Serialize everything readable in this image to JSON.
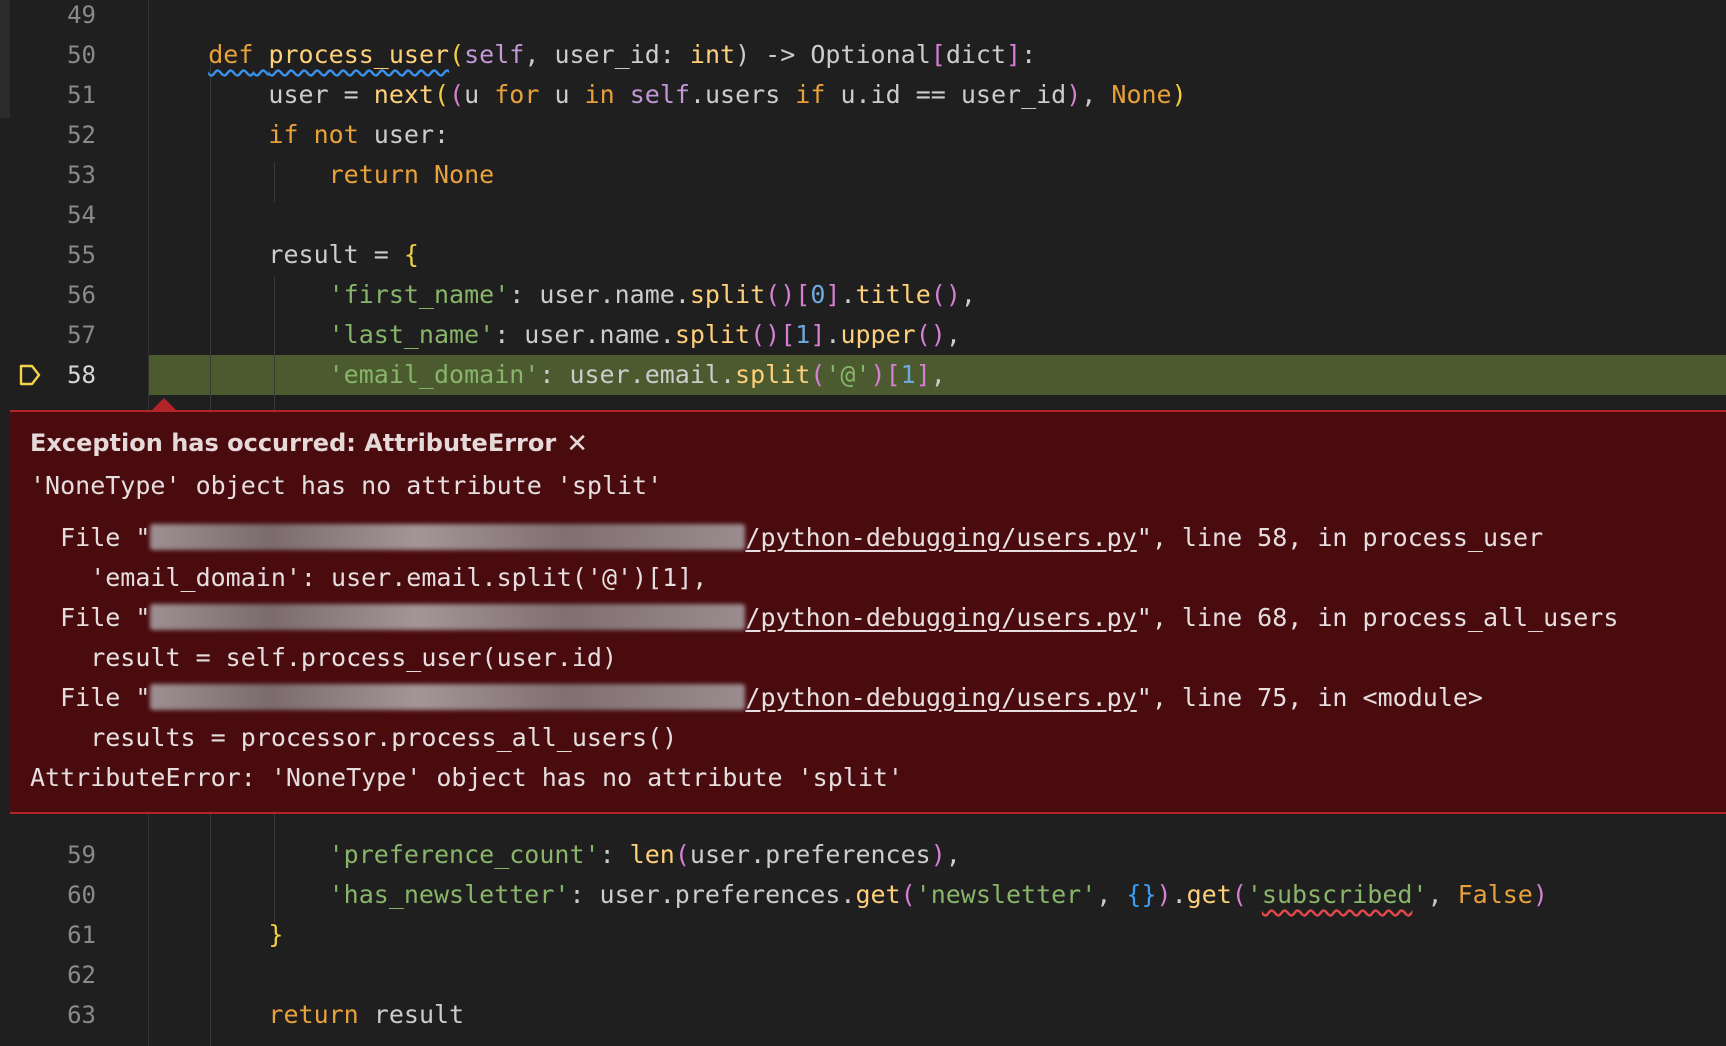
{
  "editor": {
    "lines_top": [
      {
        "num": "49",
        "segments": []
      },
      {
        "num": "50",
        "segments": [
          {
            "t": "    "
          },
          {
            "t": "def",
            "c": "kw-def squiggle-blue"
          },
          {
            "t": " ",
            "c": "squiggle-blue"
          },
          {
            "t": "process_user",
            "c": "fn squiggle-blue"
          },
          {
            "t": "(",
            "c": "p1"
          },
          {
            "t": "self",
            "c": "slf"
          },
          {
            "t": ", user_id: "
          },
          {
            "t": "int",
            "c": "builtin"
          },
          {
            "t": ") -> Optional"
          },
          {
            "t": "[",
            "c": "p2"
          },
          {
            "t": "dict"
          },
          {
            "t": "]",
            "c": "p2"
          },
          {
            "t": ":"
          }
        ]
      },
      {
        "num": "51",
        "segments": [
          {
            "t": "        user = "
          },
          {
            "t": "next",
            "c": "fn"
          },
          {
            "t": "(",
            "c": "p1"
          },
          {
            "t": "(",
            "c": "p2"
          },
          {
            "t": "u "
          },
          {
            "t": "for",
            "c": "kw"
          },
          {
            "t": " u "
          },
          {
            "t": "in",
            "c": "kw"
          },
          {
            "t": " "
          },
          {
            "t": "self",
            "c": "slf"
          },
          {
            "t": ".users "
          },
          {
            "t": "if",
            "c": "kw"
          },
          {
            "t": " u.id == user_id"
          },
          {
            "t": ")",
            "c": "p2"
          },
          {
            "t": ", "
          },
          {
            "t": "None",
            "c": "const"
          },
          {
            "t": ")",
            "c": "p1"
          }
        ]
      },
      {
        "num": "52",
        "segments": [
          {
            "t": "        "
          },
          {
            "t": "if",
            "c": "kw"
          },
          {
            "t": " "
          },
          {
            "t": "not",
            "c": "kw"
          },
          {
            "t": " user:"
          }
        ]
      },
      {
        "num": "53",
        "segments": [
          {
            "t": "            "
          },
          {
            "t": "return",
            "c": "kw"
          },
          {
            "t": " "
          },
          {
            "t": "None",
            "c": "const"
          }
        ]
      },
      {
        "num": "54",
        "segments": []
      },
      {
        "num": "55",
        "segments": [
          {
            "t": "        result = "
          },
          {
            "t": "{",
            "c": "p1"
          }
        ]
      },
      {
        "num": "56",
        "segments": [
          {
            "t": "            "
          },
          {
            "t": "'first_name'",
            "c": "str"
          },
          {
            "t": ": user.name."
          },
          {
            "t": "split",
            "c": "fn"
          },
          {
            "t": "()",
            "c": "p2"
          },
          {
            "t": "[",
            "c": "p2"
          },
          {
            "t": "0",
            "c": "num"
          },
          {
            "t": "]",
            "c": "p2"
          },
          {
            "t": "."
          },
          {
            "t": "title",
            "c": "fn"
          },
          {
            "t": "()",
            "c": "p2"
          },
          {
            "t": ","
          }
        ]
      },
      {
        "num": "57",
        "segments": [
          {
            "t": "            "
          },
          {
            "t": "'last_name'",
            "c": "str"
          },
          {
            "t": ": user.name."
          },
          {
            "t": "split",
            "c": "fn"
          },
          {
            "t": "()",
            "c": "p2"
          },
          {
            "t": "[",
            "c": "p2"
          },
          {
            "t": "1",
            "c": "num"
          },
          {
            "t": "]",
            "c": "p2"
          },
          {
            "t": "."
          },
          {
            "t": "upper",
            "c": "fn"
          },
          {
            "t": "()",
            "c": "p2"
          },
          {
            "t": ","
          }
        ]
      },
      {
        "num": "58",
        "segments": [
          {
            "t": "            "
          },
          {
            "t": "'email_domain'",
            "c": "str"
          },
          {
            "t": ": user.email."
          },
          {
            "t": "split",
            "c": "fn"
          },
          {
            "t": "(",
            "c": "p2"
          },
          {
            "t": "'@'",
            "c": "str"
          },
          {
            "t": ")",
            "c": "p2"
          },
          {
            "t": "[",
            "c": "p2"
          },
          {
            "t": "1",
            "c": "num"
          },
          {
            "t": "]",
            "c": "p2"
          },
          {
            "t": ","
          }
        ]
      }
    ],
    "lines_bottom": [
      {
        "num": "59",
        "segments": [
          {
            "t": "            "
          },
          {
            "t": "'preference_count'",
            "c": "str"
          },
          {
            "t": ": "
          },
          {
            "t": "len",
            "c": "fn"
          },
          {
            "t": "(",
            "c": "p2"
          },
          {
            "t": "user.preferences"
          },
          {
            "t": ")",
            "c": "p2"
          },
          {
            "t": ","
          }
        ]
      },
      {
        "num": "60",
        "segments": [
          {
            "t": "            "
          },
          {
            "t": "'has_newsletter'",
            "c": "str"
          },
          {
            "t": ": user.preferences."
          },
          {
            "t": "get",
            "c": "fn"
          },
          {
            "t": "(",
            "c": "p2"
          },
          {
            "t": "'newsletter'",
            "c": "str"
          },
          {
            "t": ", "
          },
          {
            "t": "{}",
            "c": "p3"
          },
          {
            "t": ")",
            "c": "p2"
          },
          {
            "t": "."
          },
          {
            "t": "get",
            "c": "fn"
          },
          {
            "t": "(",
            "c": "p2"
          },
          {
            "t": "'",
            "c": "str"
          },
          {
            "t": "subscribed",
            "c": "str squiggle-red"
          },
          {
            "t": "'",
            "c": "str"
          },
          {
            "t": ", "
          },
          {
            "t": "False",
            "c": "const"
          },
          {
            "t": ")",
            "c": "p2"
          }
        ]
      },
      {
        "num": "61",
        "segments": [
          {
            "t": "        "
          },
          {
            "t": "}",
            "c": "p1"
          }
        ]
      },
      {
        "num": "62",
        "segments": []
      },
      {
        "num": "63",
        "segments": [
          {
            "t": "        "
          },
          {
            "t": "return",
            "c": "kw"
          },
          {
            "t": " result"
          }
        ]
      }
    ]
  },
  "exception": {
    "title": "Exception has occurred: AttributeError",
    "close_glyph": "✕",
    "message": "'NoneType' object has no attribute 'split'",
    "trace": [
      {
        "prefix": "  File \"",
        "path": "/python-debugging/users.py",
        "suffix": "\", line 58, in process_user",
        "code": "    'email_domain': user.email.split('@')[1],"
      },
      {
        "prefix": "  File \"",
        "path": "/python-debugging/users.py",
        "suffix": "\", line 68, in process_all_users",
        "code": "    result = self.process_user(user.id)"
      },
      {
        "prefix": "  File \"",
        "path": "/python-debugging/users.py",
        "suffix": "\", line 75, in <module>",
        "code": "    results = processor.process_all_users()"
      }
    ],
    "final": "AttributeError: 'NoneType' object has no attribute 'split'"
  }
}
